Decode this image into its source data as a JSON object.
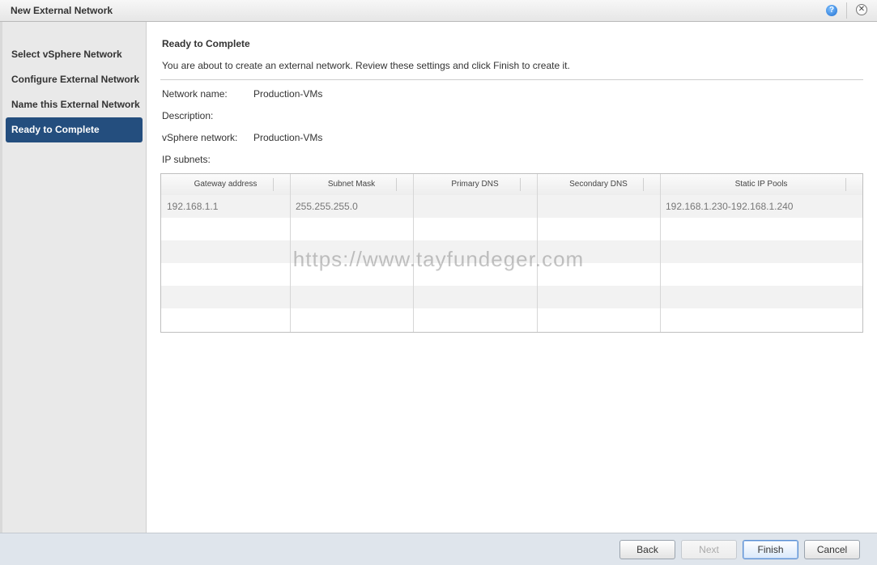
{
  "window": {
    "title": "New External Network",
    "help_icon": "question-circle-icon",
    "help_glyph": "?",
    "close_icon": "close-circle-icon",
    "close_glyph": "✕"
  },
  "sidebar": {
    "items": [
      {
        "label": "Select vSphere Network",
        "active": false
      },
      {
        "label": "Configure External Network",
        "active": false
      },
      {
        "label": "Name this External Network",
        "active": false
      },
      {
        "label": "Ready to Complete",
        "active": true
      }
    ]
  },
  "main": {
    "heading": "Ready to Complete",
    "intro": "You are about to create an external network. Review these settings and click Finish to create it.",
    "fields": {
      "network_name_label": "Network name:",
      "network_name_value": "Production-VMs",
      "description_label": "Description:",
      "description_value": "",
      "vsphere_network_label": "vSphere network:",
      "vsphere_network_value": "Production-VMs",
      "ip_subnets_label": "IP subnets:"
    },
    "table": {
      "columns": [
        "Gateway address",
        "Subnet Mask",
        "Primary DNS",
        "Secondary DNS",
        "Static IP Pools"
      ],
      "rows": [
        [
          "192.168.1.1",
          "255.255.255.0",
          "",
          "",
          "192.168.1.230-192.168.1.240"
        ]
      ]
    }
  },
  "watermark": "https://www.tayfundeger.com",
  "footer": {
    "back_label": "Back",
    "next_label": "Next",
    "finish_label": "Finish",
    "cancel_label": "Cancel"
  },
  "colors": {
    "active_step_bg": "#244e7e",
    "sidebar_bg": "#e9e9e9",
    "footer_bg": "#dfe5ec"
  }
}
